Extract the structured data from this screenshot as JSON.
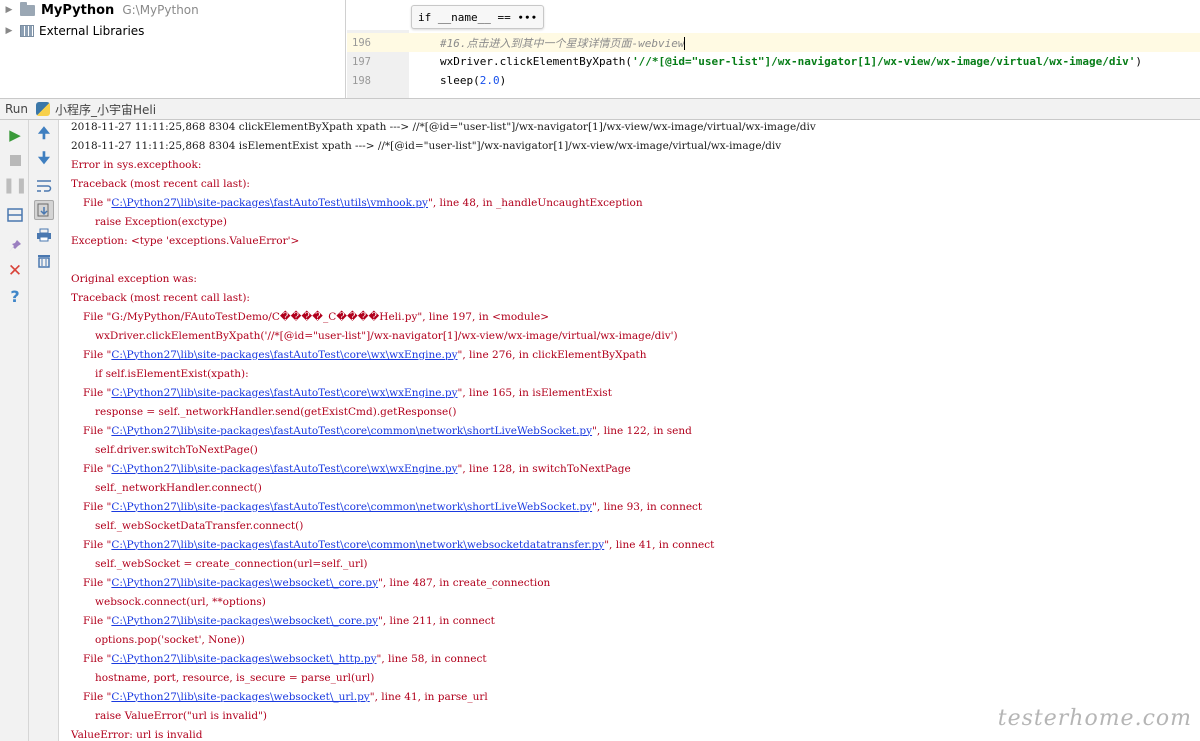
{
  "project": {
    "name": "MyPython",
    "path": "G:\\MyPython",
    "external_libraries": "External Libraries"
  },
  "editor": {
    "breadcrumb": "if __name__ == ∙∙∙",
    "lines": [
      {
        "no": "196",
        "comment": "#16.点击进入到其中一个星球详情页面-webview"
      },
      {
        "no": "197",
        "pre": "wxDriver.clickElementByXpath(",
        "str": "'//*[@id=\"user-list\"]/wx-navigator[1]/wx-view/wx-image/virtual/wx-image/div'",
        "post": ")"
      },
      {
        "no": "198",
        "pre": "sleep(",
        "num": "2.0",
        "post": ")"
      }
    ]
  },
  "run": {
    "label": "Run",
    "config_name": "小程序_小宇宙Heli"
  },
  "console": {
    "l0": "2018-11-27 11:11:25,868 8304 clickElementByXpath xpath ---> //*[@id=\"user-list\"]/wx-navigator[1]/wx-view/wx-image/virtual/wx-image/div",
    "l1": "2018-11-27 11:11:25,868 8304 isElementExist xpath ---> //*[@id=\"user-list\"]/wx-navigator[1]/wx-view/wx-image/virtual/wx-image/div",
    "l2": "Error in sys.excepthook:",
    "l3": "Traceback (most recent call last):",
    "f1": {
      "pre": "File \"",
      "link": "C:\\Python27\\lib\\site-packages\\fastAutoTest\\utils\\vmhook.py",
      "post": "\", line 48, in _handleUncaughtException"
    },
    "l5": "raise Exception(exctype)",
    "l6": "Exception: <type 'exceptions.ValueError'>",
    "l8": "Original exception was:",
    "l9": "Traceback (most recent call last):",
    "l10": "File \"G:/MyPython/FAutoTestDemo/C����_C����Heli.py\", line 197, in <module>",
    "l11": "wxDriver.clickElementByXpath('//*[@id=\"user-list\"]/wx-navigator[1]/wx-view/wx-image/virtual/wx-image/div')",
    "f2": {
      "pre": "File \"",
      "link": "C:\\Python27\\lib\\site-packages\\fastAutoTest\\core\\wx\\wxEngine.py",
      "post": "\", line 276, in clickElementByXpath"
    },
    "l13": "if self.isElementExist(xpath):",
    "f3": {
      "pre": "File \"",
      "link": "C:\\Python27\\lib\\site-packages\\fastAutoTest\\core\\wx\\wxEngine.py",
      "post": "\", line 165, in isElementExist"
    },
    "l15": "response = self._networkHandler.send(getExistCmd).getResponse()",
    "f4": {
      "pre": "File \"",
      "link": "C:\\Python27\\lib\\site-packages\\fastAutoTest\\core\\common\\network\\shortLiveWebSocket.py",
      "post": "\", line 122, in send"
    },
    "l17": "self.driver.switchToNextPage()",
    "f5": {
      "pre": "File \"",
      "link": "C:\\Python27\\lib\\site-packages\\fastAutoTest\\core\\wx\\wxEngine.py",
      "post": "\", line 128, in switchToNextPage"
    },
    "l19": "self._networkHandler.connect()",
    "f6": {
      "pre": "File \"",
      "link": "C:\\Python27\\lib\\site-packages\\fastAutoTest\\core\\common\\network\\shortLiveWebSocket.py",
      "post": "\", line 93, in connect"
    },
    "l21": "self._webSocketDataTransfer.connect()",
    "f7": {
      "pre": "File \"",
      "link": "C:\\Python27\\lib\\site-packages\\fastAutoTest\\core\\common\\network\\websocketdatatransfer.py",
      "post": "\", line 41, in connect"
    },
    "l23": "self._webSocket = create_connection(url=self._url)",
    "f8": {
      "pre": "File \"",
      "link": "C:\\Python27\\lib\\site-packages\\websocket\\_core.py",
      "post": "\", line 487, in create_connection"
    },
    "l25": "websock.connect(url, **options)",
    "f9": {
      "pre": "File \"",
      "link": "C:\\Python27\\lib\\site-packages\\websocket\\_core.py",
      "post": "\", line 211, in connect"
    },
    "l27": "options.pop('socket', None))",
    "f10": {
      "pre": "File \"",
      "link": "C:\\Python27\\lib\\site-packages\\websocket\\_http.py",
      "post": "\", line 58, in connect"
    },
    "l29": "hostname, port, resource, is_secure = parse_url(url)",
    "f11": {
      "pre": "File \"",
      "link": "C:\\Python27\\lib\\site-packages\\websocket\\_url.py",
      "post": "\", line 41, in parse_url"
    },
    "l31": "raise ValueError(\"url is invalid\")",
    "l32": "ValueError: url is invalid"
  },
  "icons": {
    "run": "play-icon",
    "stop": "stop-icon",
    "pause": "pause-icon",
    "up": "arrow-up-icon",
    "down": "arrow-down-icon",
    "wrap": "soft-wrap-icon",
    "scroll_end": "scroll-to-end-icon",
    "print": "print-icon",
    "trash": "trash-icon",
    "layout": "restore-layout-icon",
    "pin": "pin-icon",
    "close": "close-icon",
    "help": "help-icon"
  },
  "watermark": "testerhome.com"
}
